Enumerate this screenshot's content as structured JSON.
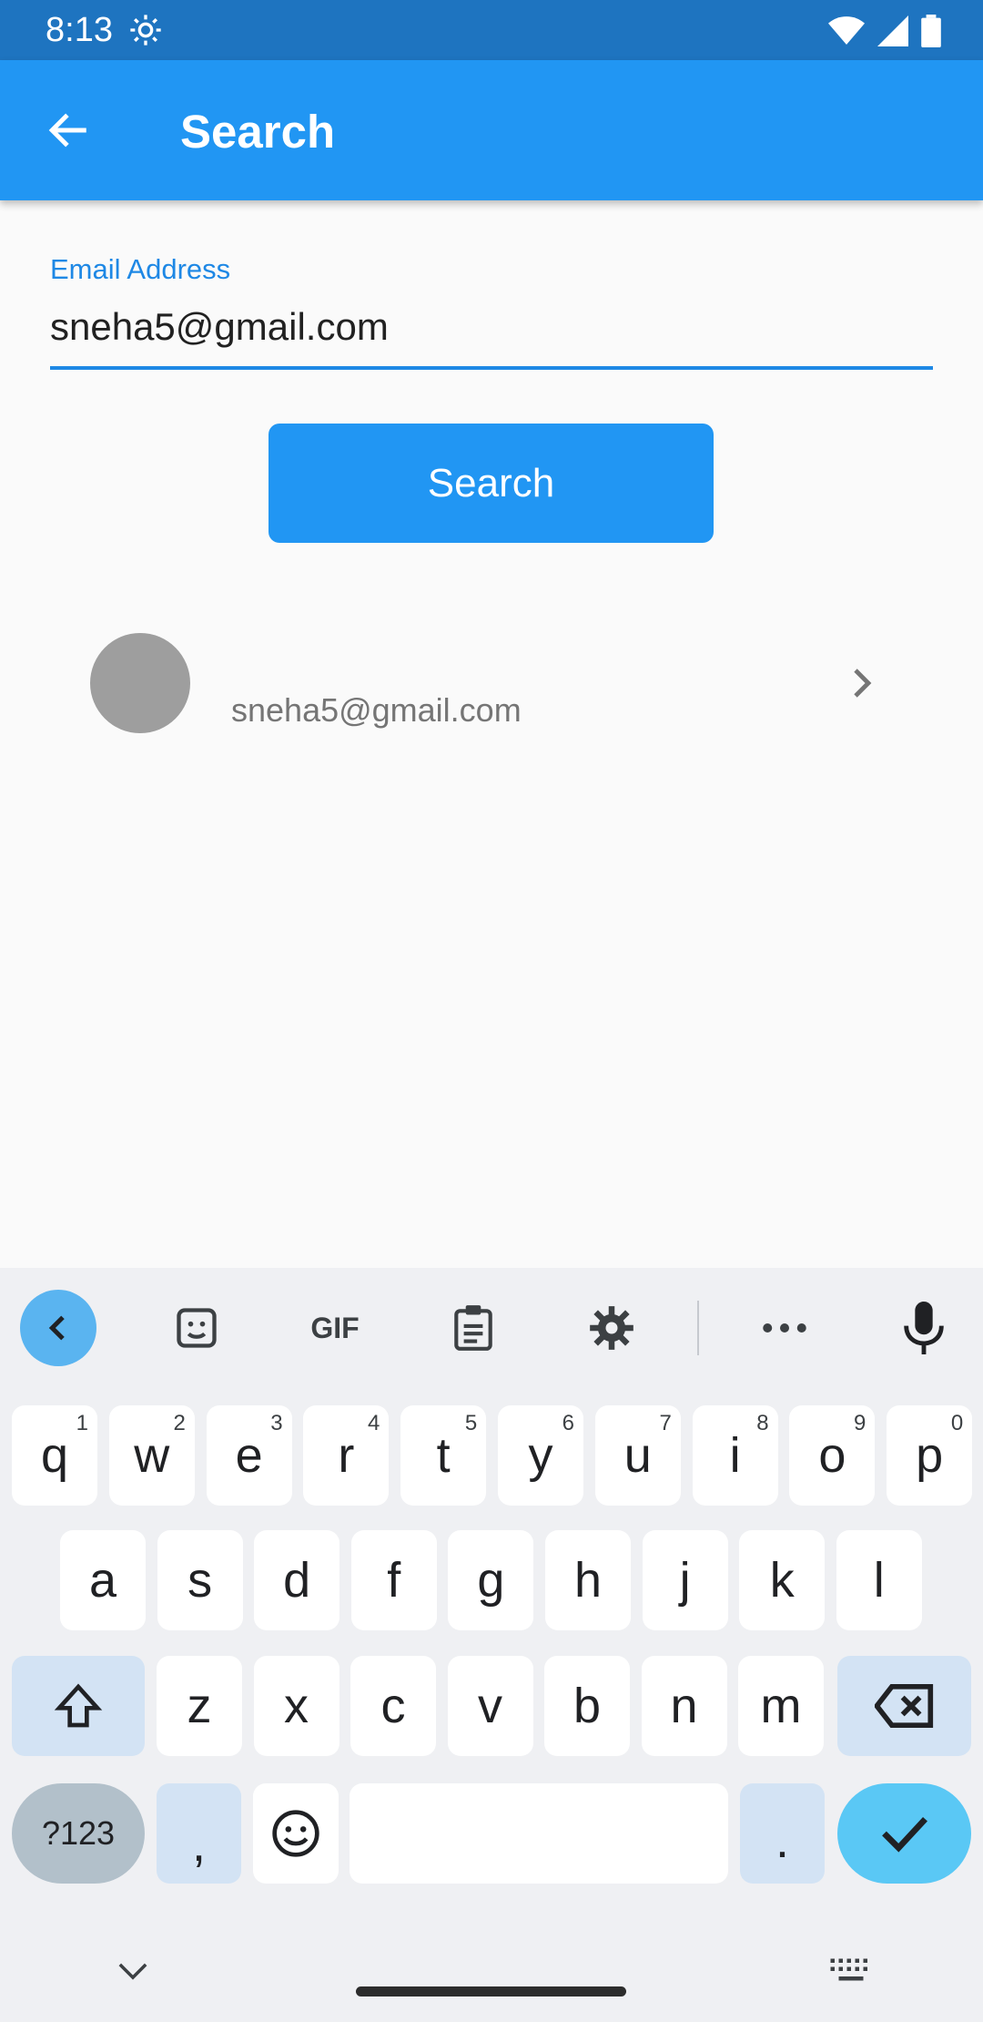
{
  "status_bar": {
    "time": "8:13"
  },
  "app_bar": {
    "title": "Search"
  },
  "form": {
    "email_label": "Email Address",
    "email_value": "sneha5@gmail.com",
    "search_button": "Search"
  },
  "results": [
    {
      "email": "sneha5@gmail.com"
    }
  ],
  "keyboard": {
    "row1": [
      {
        "key": "q",
        "num": "1"
      },
      {
        "key": "w",
        "num": "2"
      },
      {
        "key": "e",
        "num": "3"
      },
      {
        "key": "r",
        "num": "4"
      },
      {
        "key": "t",
        "num": "5"
      },
      {
        "key": "y",
        "num": "6"
      },
      {
        "key": "u",
        "num": "7"
      },
      {
        "key": "i",
        "num": "8"
      },
      {
        "key": "o",
        "num": "9"
      },
      {
        "key": "p",
        "num": "0"
      }
    ],
    "row2": [
      "a",
      "s",
      "d",
      "f",
      "g",
      "h",
      "j",
      "k",
      "l"
    ],
    "row3": [
      "z",
      "x",
      "c",
      "v",
      "b",
      "n",
      "m"
    ],
    "symbols_key": "?123",
    "comma_key": ",",
    "period_key": ".",
    "toolbar_icons": [
      "collapse-icon",
      "sticker-icon",
      "gif-icon",
      "clipboard-icon",
      "settings-icon",
      "more-icon",
      "mic-icon"
    ],
    "gif_label": "GIF"
  },
  "colors": {
    "primary": "#2196f3",
    "status_bar": "#1e74c0",
    "accent_key": "#5ac8f5"
  }
}
